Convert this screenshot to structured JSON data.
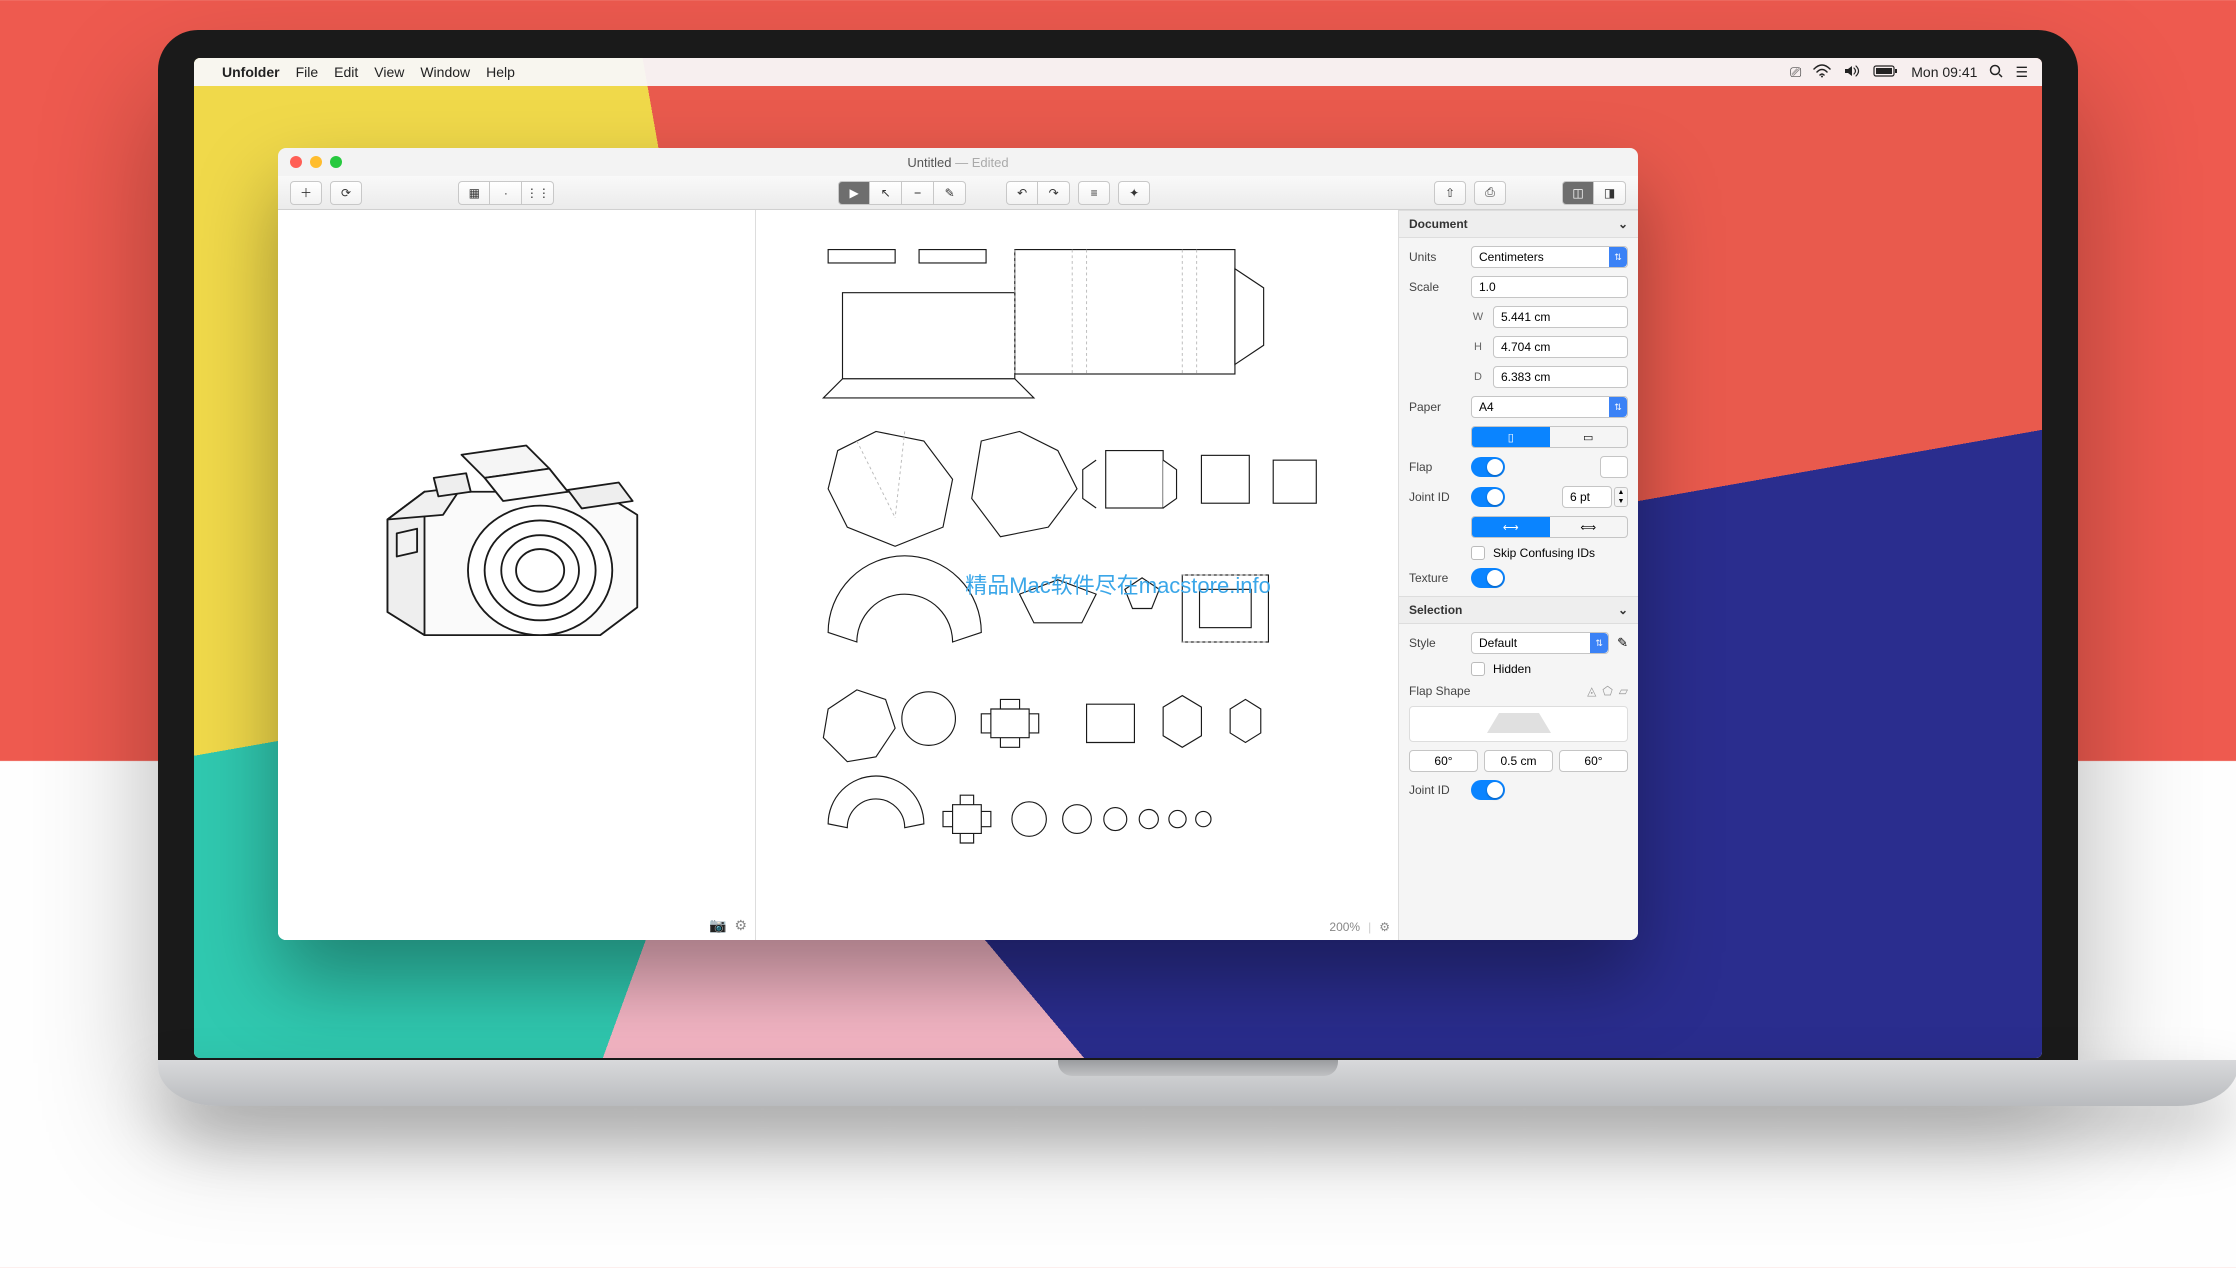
{
  "menubar": {
    "app_name": "Unfolder",
    "items": [
      "File",
      "Edit",
      "View",
      "Window",
      "Help"
    ],
    "clock": "Mon 09:41"
  },
  "window": {
    "title": "Untitled",
    "edited": "— Edited"
  },
  "inspector": {
    "document": {
      "header": "Document",
      "units_label": "Units",
      "units_value": "Centimeters",
      "scale_label": "Scale",
      "scale_value": "1.0",
      "w_label": "W",
      "w_value": "5.441 cm",
      "h_label": "H",
      "h_value": "4.704 cm",
      "d_label": "D",
      "d_value": "6.383 cm",
      "paper_label": "Paper",
      "paper_value": "A4",
      "flap_label": "Flap",
      "jointid_label": "Joint ID",
      "jointid_value": "6 pt",
      "skip_label": "Skip Confusing IDs",
      "texture_label": "Texture"
    },
    "selection": {
      "header": "Selection",
      "style_label": "Style",
      "style_value": "Default",
      "hidden_label": "Hidden",
      "flapshape_label": "Flap Shape",
      "angle1": "60°",
      "length": "0.5 cm",
      "angle2": "60°",
      "jointid_label": "Joint ID"
    }
  },
  "footer": {
    "zoom": "200%"
  },
  "watermark": "精品Mac软件尽在macstore.info"
}
